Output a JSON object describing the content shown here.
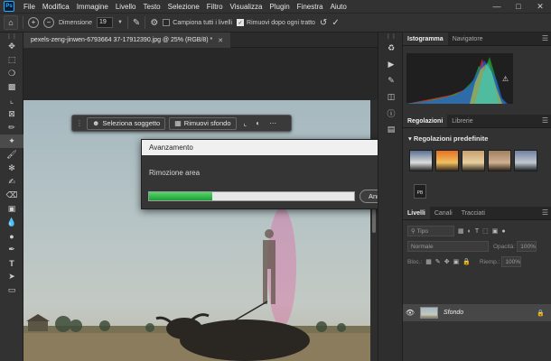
{
  "menubar": {
    "logo": "Ps",
    "items": [
      "File",
      "Modifica",
      "Immagine",
      "Livello",
      "Testo",
      "Selezione",
      "Filtro",
      "Visualizza",
      "Plugin",
      "Finestra",
      "Aiuto"
    ]
  },
  "options": {
    "dimension_label": "Dimensione",
    "dimension_value": "19",
    "sample_all_label": "Campiona tutti i livelli",
    "remove_after_label": "Rimuovi dopo ogni tratto"
  },
  "document": {
    "tab_title": "pexels-zeng-jinwen-6793664 37-17912390.jpg @ 25% (RGB/8) *"
  },
  "context_bar": {
    "select_subject": "Seleziona soggetto",
    "remove_background": "Rimuovi sfondo"
  },
  "dialog": {
    "title": "Avanzamento",
    "status": "Rimozione area",
    "progress": 0.31,
    "cancel": "Annulla"
  },
  "panels": {
    "histogram_tab": "Istogramma",
    "navigator_tab": "Navigatore",
    "adjustments_tab": "Regolazioni",
    "libraries_tab": "Librerie",
    "presets_header": "Regolazioni predefinite",
    "pb_label": "PB",
    "layers_tab": "Livelli",
    "channels_tab": "Canali",
    "paths_tab": "Tracciati",
    "search_kind": "Tipo",
    "blend_mode": "Normale",
    "opacity_label": "Opacità:",
    "opacity_value": "100%",
    "lock_label": "Bloc.:",
    "fill_label": "Riemp.:",
    "fill_value": "100%",
    "layer_name": "Sfondo"
  },
  "colors": {
    "app_bg": "#2b2b2b",
    "progress_green": "#1aa034",
    "mask_pink": "#e65aa0"
  }
}
